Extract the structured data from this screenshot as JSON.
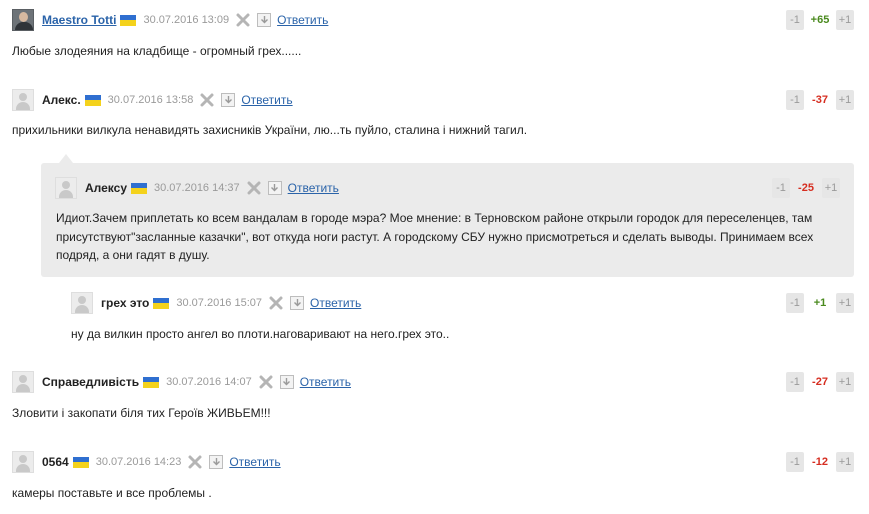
{
  "reply_label": "Ответить",
  "colors": {
    "link": "#2a63a9",
    "positive": "#4a8a1e",
    "negative": "#d62d20",
    "bubble": "#ebebeb"
  },
  "icons": {
    "avatar_default": "user-silhouette",
    "flag": "ukraine-flag",
    "delete": "x-icon",
    "download": "download-icon"
  },
  "comments": [
    {
      "author": "Maestro Totti",
      "date": "30.07.2016 13:09",
      "minus": "-1",
      "score": "+65",
      "plus": "+1",
      "text": "Любые злодеяния на кладбище - огромный грех......"
    },
    {
      "author": "Алекс.",
      "date": "30.07.2016 13:58",
      "minus": "-1",
      "score": "-37",
      "plus": "+1",
      "text": "прихильники вилкула ненавидять захисників України, лю...ть пуйло, сталина і нижний тагил."
    },
    {
      "author": "Алексу",
      "date": "30.07.2016 14:37",
      "minus": "-1",
      "score": "-25",
      "plus": "+1",
      "text": "Идиот.Зачем приплетать ко всем вандалам в городе мэра? Мое мнение: в Терновском районе открыли городок для переселенцев, там присутствуют\"засланные казачки\", вот откуда ноги растут. А городскому СБУ нужно присмотреться и сделать выводы. Принимаем всех подряд, а они гадят в душу."
    },
    {
      "author": "грех это",
      "date": "30.07.2016 15:07",
      "minus": "-1",
      "score": "+1",
      "plus": "+1",
      "text": "ну да вилкин просто ангел во плоти.наговаривают на него.грех это.."
    },
    {
      "author": "Справедливість",
      "date": "30.07.2016 14:07",
      "minus": "-1",
      "score": "-27",
      "plus": "+1",
      "text": "Зловити і закопати біля тих Героїв ЖИВЬЕМ!!!"
    },
    {
      "author": "0564",
      "date": "30.07.2016 14:23",
      "minus": "-1",
      "score": "-12",
      "plus": "+1",
      "text": "камеры поставьте и все проблемы ."
    }
  ]
}
